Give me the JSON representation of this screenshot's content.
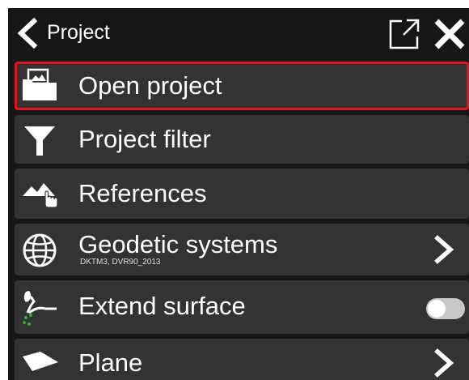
{
  "header": {
    "title": "Project"
  },
  "menu": {
    "items": [
      {
        "label": "Open project",
        "icon": "open-folder-icon",
        "selected": true
      },
      {
        "label": "Project filter",
        "icon": "funnel-icon"
      },
      {
        "label": "References",
        "icon": "references-icon"
      },
      {
        "label": "Geodetic systems",
        "sublabel": "DKTM3, DVR90_2013",
        "icon": "globe-icon",
        "trailing": "chevron-right-icon"
      },
      {
        "label": "Extend surface",
        "icon": "extend-surface-icon",
        "trailing": "toggle",
        "toggle_on": false
      },
      {
        "label": "Plane",
        "icon": "plane-icon",
        "trailing": "chevron-right-icon"
      }
    ]
  },
  "colors": {
    "background": "#161616",
    "item": "#333333",
    "selected_border": "#e0141e",
    "text": "#ffffff",
    "toggle_track": "#c8c8c8"
  }
}
